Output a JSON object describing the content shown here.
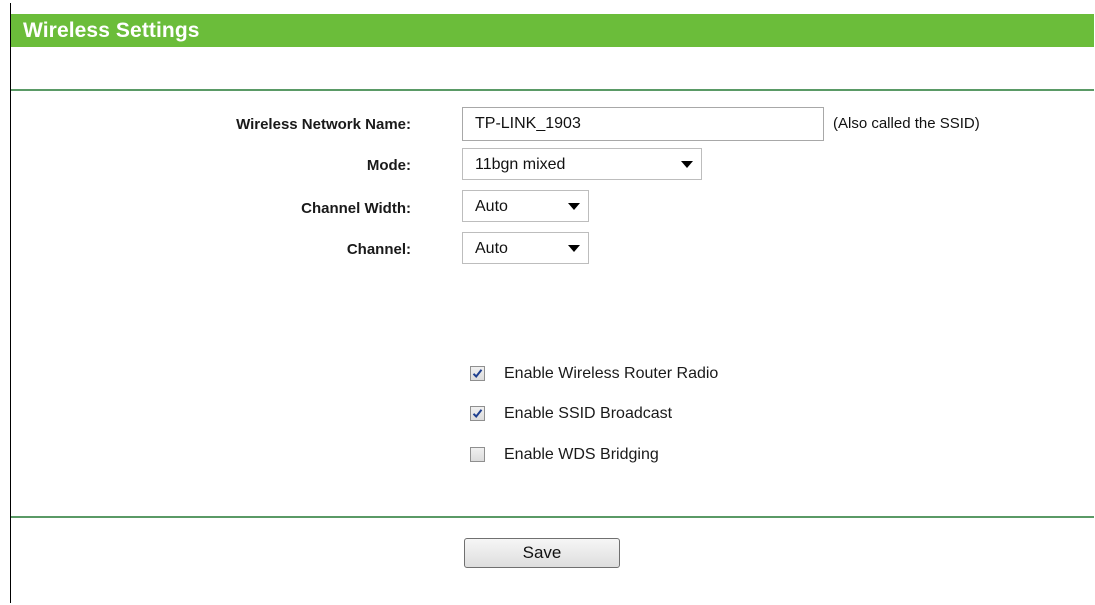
{
  "header": {
    "title": "Wireless Settings"
  },
  "colors": {
    "header_bg": "#6bbd3a",
    "divider": "#5a9a66"
  },
  "form": {
    "network_name": {
      "label": "Wireless Network Name:",
      "value": "TP-LINK_1903",
      "hint": "(Also called the SSID)"
    },
    "mode": {
      "label": "Mode:",
      "selected": "11bgn mixed"
    },
    "channel_width": {
      "label": "Channel Width:",
      "selected": "Auto"
    },
    "channel": {
      "label": "Channel:",
      "selected": "Auto"
    }
  },
  "options": [
    {
      "label": "Enable Wireless Router Radio",
      "checked": true
    },
    {
      "label": "Enable SSID Broadcast",
      "checked": true
    },
    {
      "label": "Enable WDS Bridging",
      "checked": false
    }
  ],
  "actions": {
    "save_label": "Save"
  }
}
